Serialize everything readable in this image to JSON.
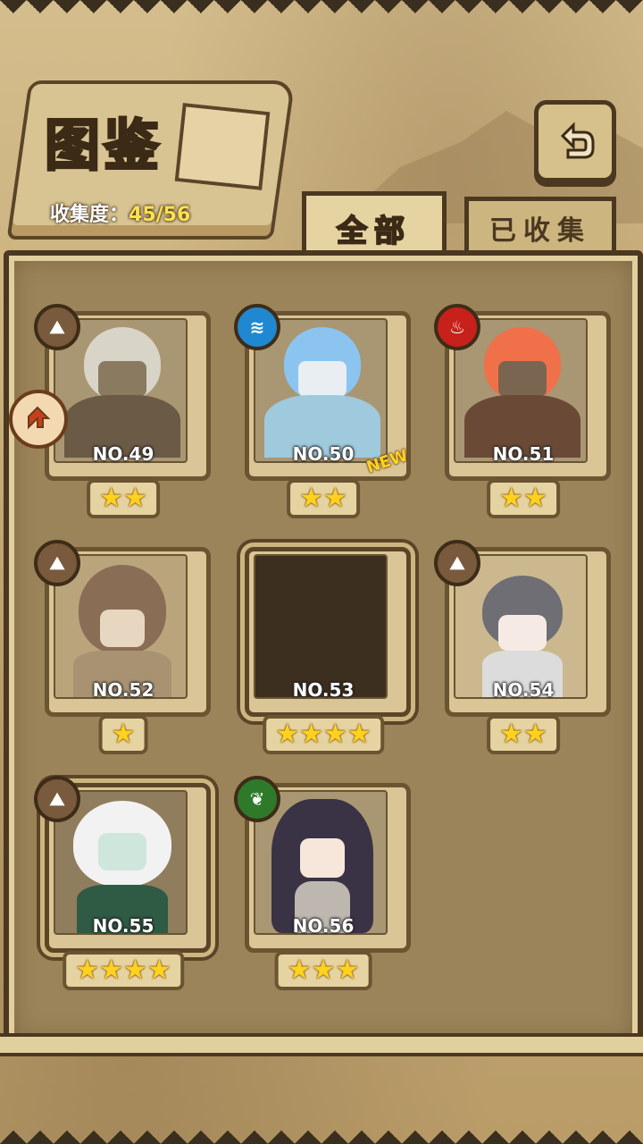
{
  "header": {
    "title": "图鉴",
    "progress_label": "收集度：",
    "progress_value": "45/56"
  },
  "tabs": [
    {
      "label": "全部",
      "active": true
    },
    {
      "label": "已收集",
      "active": false
    }
  ],
  "cards": [
    {
      "number": "NO.49",
      "stars": "★★",
      "element": "earth",
      "hair": "#d9d4c8",
      "body": "#6b5a45",
      "new": false
    },
    {
      "number": "NO.50",
      "stars": "★★",
      "element": "water",
      "hair": "#8cc4f0",
      "body": "#9fc9dd",
      "new": true,
      "new_label": "NEW"
    },
    {
      "number": "NO.51",
      "stars": "★★",
      "element": "fire",
      "hair": "#f0704a",
      "body": "#6a4a36",
      "new": false
    },
    {
      "number": "NO.52",
      "stars": "★",
      "element": "earth",
      "hair": "#8a6d55",
      "body": "#a89272",
      "new": false
    },
    {
      "number": "NO.53",
      "stars": "★★★★",
      "element": "",
      "locked": true
    },
    {
      "number": "NO.54",
      "stars": "★★",
      "element": "earth",
      "hair": "#6e6e74",
      "body": "#dcdcdc",
      "new": false
    },
    {
      "number": "NO.55",
      "stars": "★★★★",
      "element": "earth",
      "hair": "#f2f2f2",
      "body": "#2f5a44",
      "new": false
    },
    {
      "number": "NO.56",
      "stars": "★★★",
      "element": "wood",
      "hair": "#3a3345",
      "body": "#bdb7b0",
      "new": false
    }
  ],
  "icons": {
    "back": "back-arrow-icon",
    "earth": "earth-element-icon",
    "water": "water-element-icon",
    "fire": "fire-element-icon",
    "wood": "wood-element-icon",
    "side": "side-arrow-icon"
  }
}
